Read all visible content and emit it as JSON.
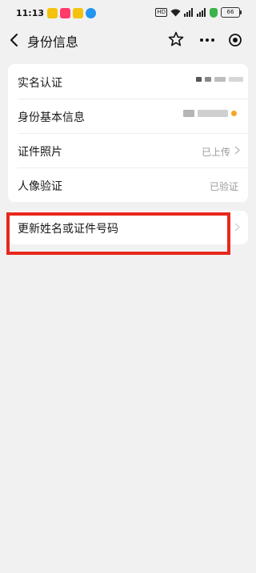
{
  "status_bar": {
    "time": "11:13",
    "hd_label": "HD",
    "battery_level": "66",
    "app_icon_colors": [
      "#f4c20d",
      "#ff3b6b",
      "#f4c20d",
      "#2196f3"
    ]
  },
  "nav": {
    "title": "身份信息",
    "icons": [
      "back-arrow",
      "star",
      "more",
      "target"
    ]
  },
  "info_rows": [
    {
      "label": "实名认证",
      "value": "",
      "value_masked": true,
      "has_arrow": false
    },
    {
      "label": "身份基本信息",
      "value": "",
      "value_masked": true,
      "has_arrow": false
    },
    {
      "label": "证件照片",
      "value": "已上传",
      "has_arrow": true
    },
    {
      "label": "人像验证",
      "value": "已验证",
      "has_arrow": false
    }
  ],
  "update_action": {
    "label": "更新姓名或证件号码",
    "has_arrow": true
  },
  "colors": {
    "background": "#f1f1f1",
    "card": "#ffffff",
    "highlight": "#e8271c",
    "value_text": "#9b9b9b"
  }
}
